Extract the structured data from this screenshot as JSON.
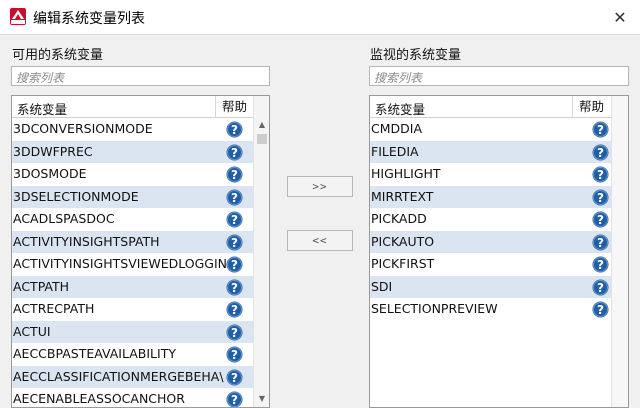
{
  "window": {
    "title": "编辑系统变量列表",
    "close_glyph": "✕"
  },
  "available": {
    "label": "可用的系统变量",
    "search_placeholder": "搜索列表",
    "col_name": "系统变量",
    "col_help": "帮助",
    "items": [
      "3DCONVERSIONMODE",
      "3DDWFPREC",
      "3DOSMODE",
      "3DSELECTIONMODE",
      "ACADLSPASDOC",
      "ACTIVITYINSIGHTSPATH",
      "ACTIVITYINSIGHTSVIEWEDLOGGIN",
      "ACTPATH",
      "ACTRECPATH",
      "ACTUI",
      "AECCBPASTEAVAILABILITY",
      "AECCLASSIFICATIONMERGEBEHA\\",
      "AECENABLEASSOCANCHOR"
    ]
  },
  "monitored": {
    "label": "监视的系统变量",
    "search_placeholder": "搜索列表",
    "col_name": "系统变量",
    "col_help": "帮助",
    "items": [
      "CMDDIA",
      "FILEDIA",
      "HIGHLIGHT",
      "MIRRTEXT",
      "PICKADD",
      "PICKAUTO",
      "PICKFIRST",
      "SDI",
      "SELECTIONPREVIEW"
    ]
  },
  "buttons": {
    "add": ">>",
    "remove": "<<"
  },
  "icons": {
    "help": "help-icon",
    "app": "autocad-icon"
  },
  "colors": {
    "row_alt": "#dbe5f1",
    "help_icon": "#1f5fa8",
    "app_icon": "#c8102e"
  }
}
